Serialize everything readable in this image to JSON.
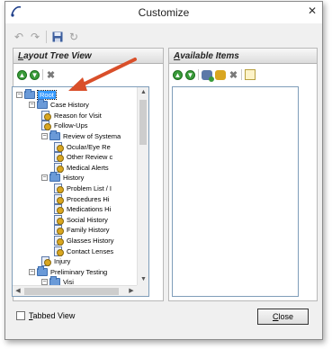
{
  "window": {
    "title": "Customize",
    "close_glyph": "✕"
  },
  "toolbar": {
    "undo_icon": "undo-icon",
    "redo_icon": "redo-icon",
    "save_icon": "save-icon",
    "refresh_icon": "refresh-icon"
  },
  "left_panel": {
    "title": "Layout Tree View",
    "title_access_key": "L",
    "title_rest": "ayout Tree View",
    "tools": [
      "move-up-icon",
      "move-down-icon",
      "delete-icon"
    ]
  },
  "right_panel": {
    "title": "Available Items",
    "title_access_key": "A",
    "title_rest": "vailable Items",
    "tools": [
      "move-up-icon",
      "move-down-icon",
      "add-item-icon",
      "add-special-icon",
      "delete-icon",
      "tree-view-icon"
    ]
  },
  "tree": {
    "items": [
      {
        "label": "Root",
        "kind": "folder",
        "level": 0,
        "expanded": true,
        "selected": true
      },
      {
        "label": "Case History",
        "kind": "folder",
        "level": 1,
        "expanded": true
      },
      {
        "label": "Reason for Visit",
        "kind": "leaf",
        "level": 2
      },
      {
        "label": "Follow-Ups",
        "kind": "leaf",
        "level": 2
      },
      {
        "label": "Review of Systema",
        "kind": "folder",
        "level": 2,
        "expanded": true
      },
      {
        "label": "Ocular/Eye Re",
        "kind": "leaf",
        "level": 3
      },
      {
        "label": "Other Review c",
        "kind": "leaf",
        "level": 3
      },
      {
        "label": "Medical Alerts",
        "kind": "leaf",
        "level": 3
      },
      {
        "label": "History",
        "kind": "folder",
        "level": 2,
        "expanded": true
      },
      {
        "label": "Problem List / I",
        "kind": "leaf",
        "level": 3
      },
      {
        "label": "Procedures Hi",
        "kind": "leaf",
        "level": 3
      },
      {
        "label": "Medications Hi",
        "kind": "leaf",
        "level": 3
      },
      {
        "label": "Social History",
        "kind": "leaf",
        "level": 3
      },
      {
        "label": "Family History",
        "kind": "leaf",
        "level": 3
      },
      {
        "label": "Glasses History",
        "kind": "leaf",
        "level": 3
      },
      {
        "label": "Contact Lenses",
        "kind": "leaf",
        "level": 3
      },
      {
        "label": "Injury",
        "kind": "leaf",
        "level": 2
      },
      {
        "label": "Preliminary Testing",
        "kind": "folder",
        "level": 1,
        "expanded": true
      },
      {
        "label": "Visi",
        "kind": "folder",
        "level": 2,
        "expanded": true
      }
    ]
  },
  "footer": {
    "tabbed_view": {
      "access_key": "T",
      "rest": "abbed View",
      "checked": false
    },
    "close_button": {
      "access_key": "C",
      "rest": "lose"
    }
  },
  "colors": {
    "selection": "#3399ff",
    "annotation_arrow": "#d94f2a",
    "frame_border": "#7f9db9"
  }
}
